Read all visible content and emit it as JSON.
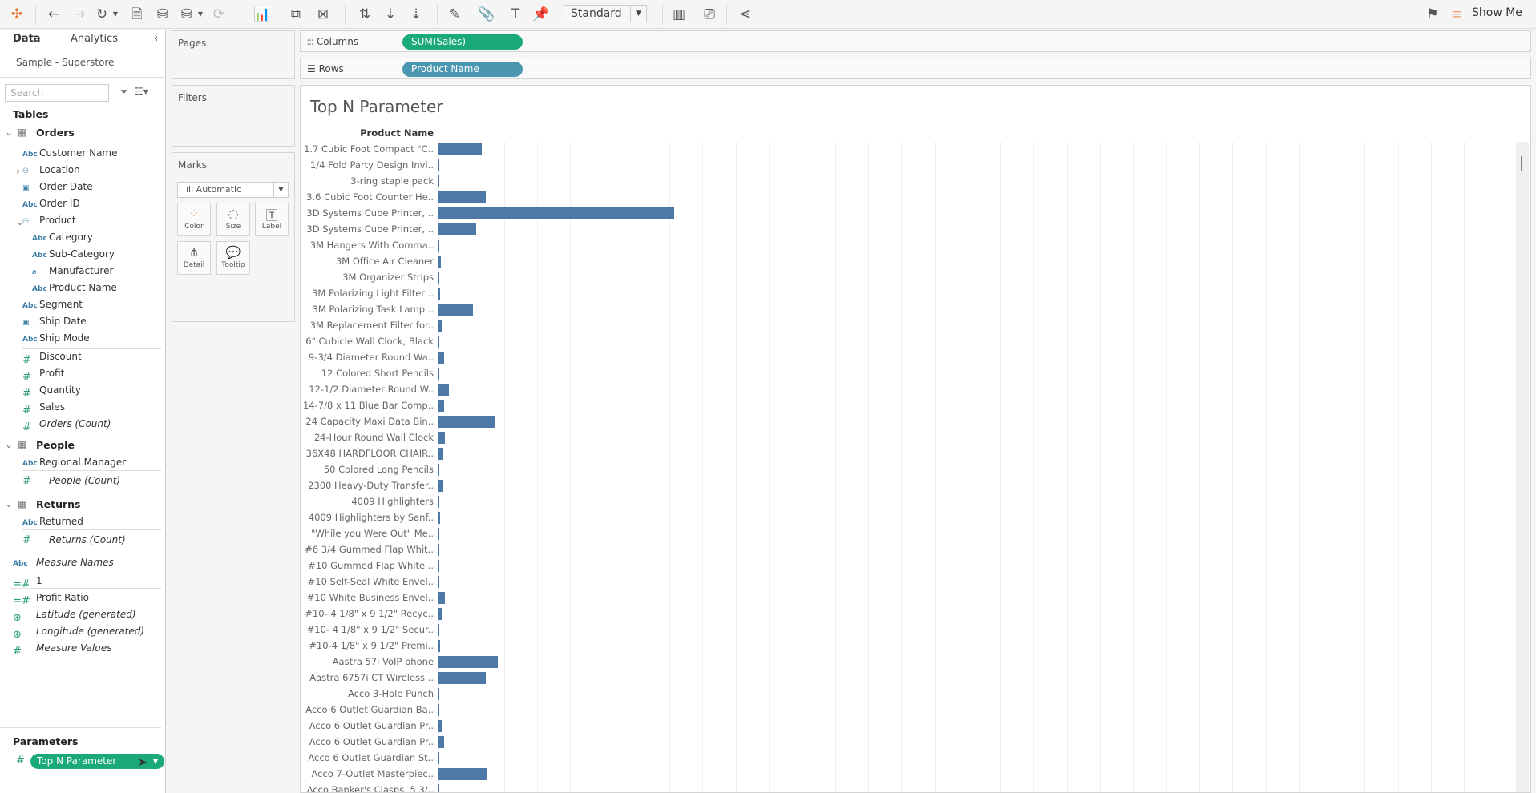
{
  "toolbar": {
    "mark_type_fit": "Standard",
    "show_me": "Show Me"
  },
  "left_panel": {
    "tabs": [
      "Data",
      "Analytics"
    ],
    "datasource": "Sample - Superstore",
    "search_placeholder": "Search",
    "tables_header": "Tables",
    "groups": {
      "orders": "Orders",
      "people": "People",
      "returns": "Returns"
    },
    "orders_fields": [
      "Customer Name",
      "Location",
      "Order Date",
      "Order ID",
      "Product",
      "Category",
      "Sub-Category",
      "Manufacturer",
      "Product Name",
      "Segment",
      "Ship Date",
      "Ship Mode",
      "Discount",
      "Profit",
      "Quantity",
      "Sales",
      "Orders (Count)"
    ],
    "people_fields": [
      "Regional Manager",
      "People (Count)"
    ],
    "returns_fields": [
      "Returned",
      "Returns (Count)"
    ],
    "other_fields": [
      "Measure Names",
      "1",
      "Profit Ratio",
      "Latitude (generated)",
      "Longitude (generated)",
      "Measure Values"
    ],
    "parameters_header": "Parameters",
    "parameter": "Top N Parameter"
  },
  "cards": {
    "pages": "Pages",
    "filters": "Filters",
    "marks": "Marks",
    "mark_type": "Automatic",
    "buttons": [
      "Color",
      "Size",
      "Label",
      "Detail",
      "Tooltip"
    ]
  },
  "shelves": {
    "columns_label": "Columns",
    "columns_pill": "SUM(Sales)",
    "rows_label": "Rows",
    "rows_pill": "Product Name"
  },
  "colors": {
    "bar": "#4e79a7",
    "measure_pill": "#1aa97a",
    "dimension_pill": "#4a96b0"
  },
  "chart_data": {
    "type": "bar",
    "title": "Top N Parameter",
    "ylabel": "Product Name",
    "xlabel": "Sales",
    "grid_step": 2000,
    "categories": [
      "1.7 Cubic Foot Compact \"C..",
      "1/4 Fold Party Design Invi..",
      "3-ring staple pack",
      "3.6 Cubic Foot Counter He..",
      "3D Systems Cube Printer, ..",
      "3D Systems Cube Printer, ..",
      "3M Hangers With Comma..",
      "3M Office Air Cleaner",
      "3M Organizer Strips",
      "3M Polarizing Light Filter ..",
      "3M Polarizing Task Lamp ..",
      "3M Replacement Filter for..",
      "6\" Cubicle Wall Clock, Black",
      "9-3/4 Diameter Round Wa..",
      "12 Colored Short Pencils",
      "12-1/2 Diameter Round W..",
      "14-7/8 x 11 Blue Bar Comp..",
      "24 Capacity Maxi Data Bin..",
      "24-Hour Round Wall Clock",
      "36X48 HARDFLOOR CHAIR..",
      "50 Colored Long Pencils",
      "2300 Heavy-Duty Transfer..",
      "4009 Highlighters",
      "4009 Highlighters by Sanf..",
      "\"While you Were Out\" Me..",
      "#6 3/4 Gummed Flap Whit..",
      "#10 Gummed Flap White ..",
      "#10 Self-Seal White Envel..",
      "#10 White Business Envel..",
      "#10- 4 1/8\" x 9 1/2\" Recyc..",
      "#10- 4 1/8\" x 9 1/2\" Secur..",
      "#10-4 1/8\" x 9 1/2\" Premi..",
      "Aastra 57i VoIP phone",
      "Aastra 6757i CT Wireless ..",
      "Acco 3-Hole Punch",
      "Acco 6 Outlet Guardian Ba..",
      "Acco 6 Outlet Guardian Pr..",
      "Acco 6 Outlet Guardian Pr..",
      "Acco 6 Outlet Guardian St..",
      "Acco 7-Outlet Masterpiec..",
      "Acco Banker's Clasps, 5 3/.."
    ],
    "values": [
      2660,
      30,
      20,
      2900,
      14300,
      2320,
      50,
      200,
      40,
      150,
      2130,
      240,
      100,
      390,
      20,
      680,
      390,
      3480,
      440,
      340,
      100,
      290,
      20,
      150,
      20,
      20,
      20,
      40,
      440,
      240,
      100,
      150,
      3630,
      2900,
      100,
      20,
      240,
      390,
      100,
      3000,
      100
    ]
  }
}
